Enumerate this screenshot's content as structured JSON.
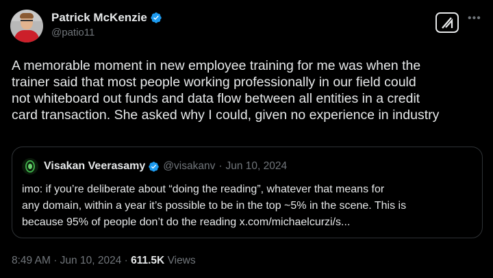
{
  "tweet": {
    "author": {
      "display_name": "Patrick McKenzie",
      "handle": "@patio11",
      "verified": true
    },
    "text_lines": [
      "A memorable moment in new employee training for me was when the",
      "trainer said that most people working professionally in our field could",
      "not whiteboard out funds and data flow between all entities in a credit",
      "card transaction. She asked why I could, given no experience in industry"
    ],
    "more_icon": "more-horizontal-icon",
    "grok_icon": "grok-icon",
    "time": "8:49 AM",
    "sep": "·",
    "date": "Jun 10, 2024",
    "views_count": "611.5K",
    "views_label": "Views"
  },
  "quote": {
    "author": {
      "display_name": "Visakan Veerasamy",
      "handle": "@visakanv",
      "verified": true
    },
    "sep": "·",
    "date": "Jun 10, 2024",
    "text_lines": [
      "imo: if you’re deliberate about “doing the reading”, whatever that means for",
      "any domain, within a year it’s possible to be in the top ~5% in the scene. This is",
      "because 95% of people don’t do the reading x.com/michaelcurzi/s..."
    ]
  },
  "colors": {
    "verified_blue": "#1d9bf0",
    "muted": "#71767b",
    "text": "#e7e9ea",
    "border": "#2f3336"
  }
}
